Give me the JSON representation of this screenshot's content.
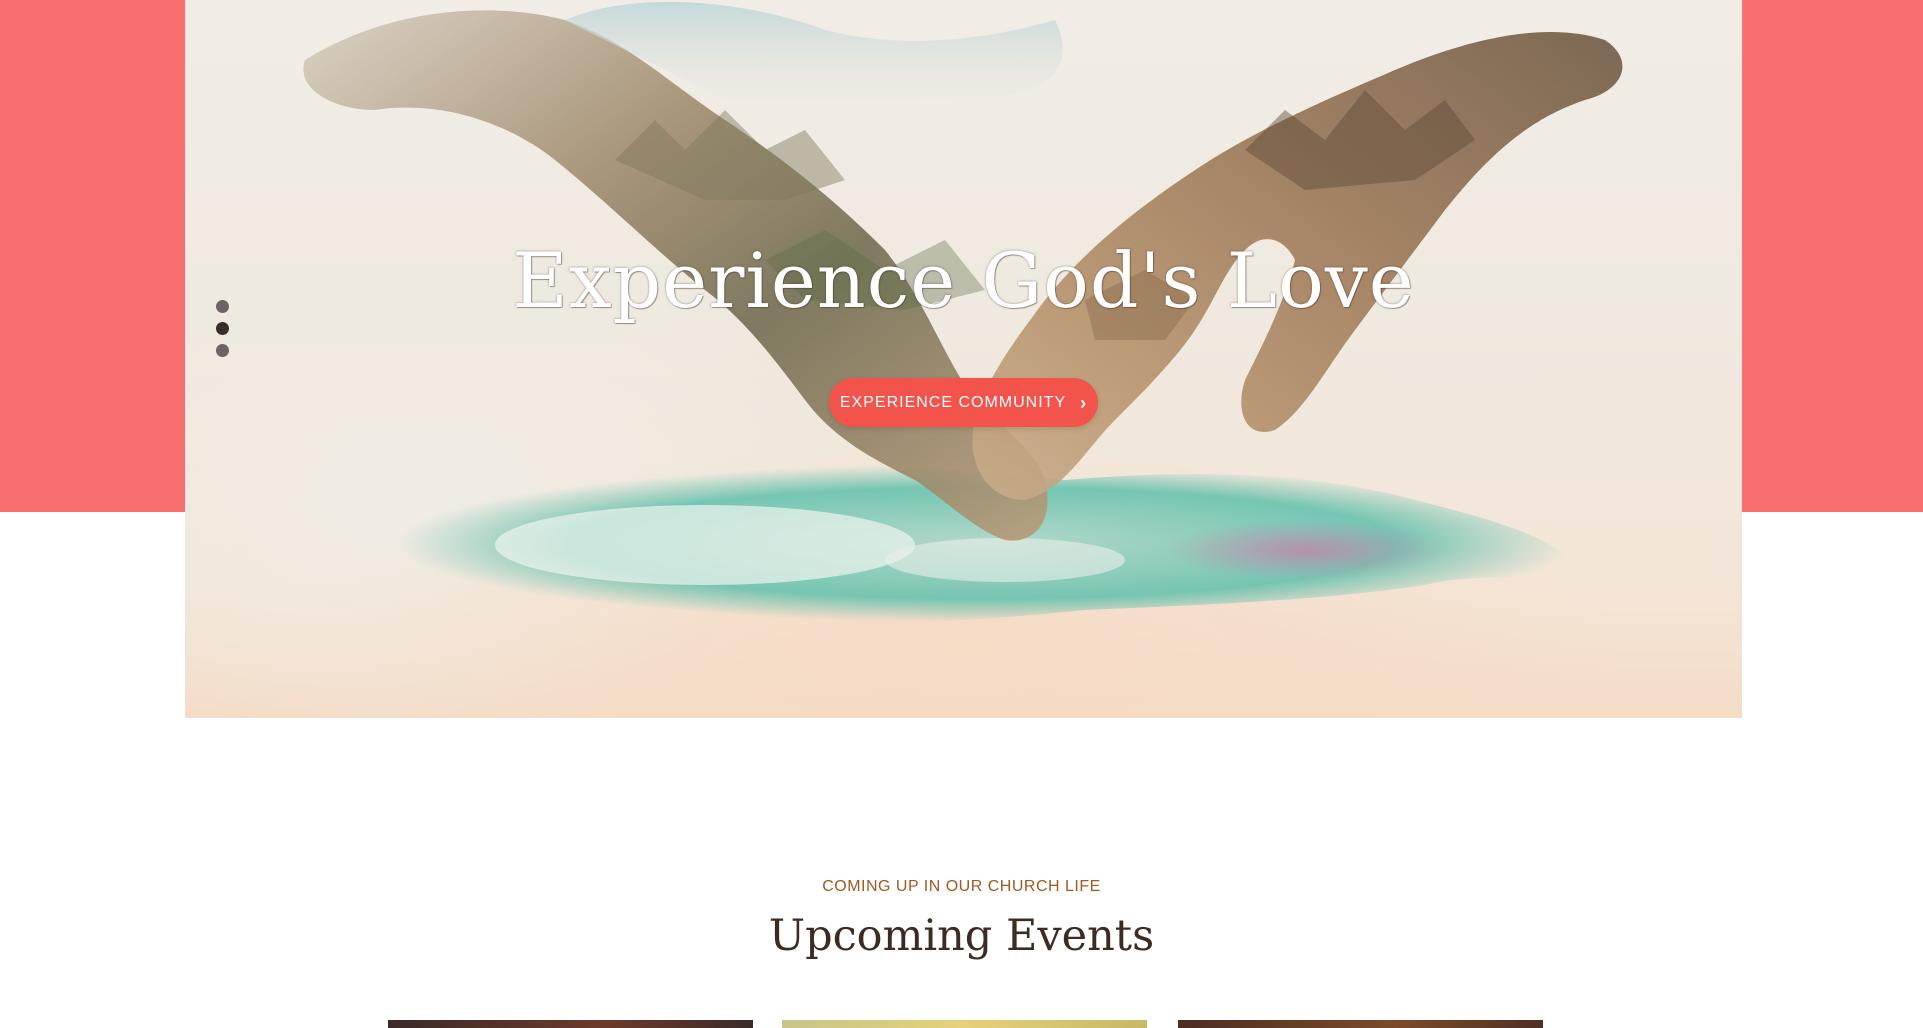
{
  "hero": {
    "title": "Experience God's Love",
    "cta_label": "EXPERIENCE COMMUNITY",
    "cta_icon": "chevron-right-icon",
    "slider": {
      "slide_count": 3,
      "active_index": 1
    },
    "accent_color": "#f96f6e",
    "button_color": "#f2534a"
  },
  "events": {
    "kicker": "COMING UP IN OUR CHURCH LIFE",
    "title": "Upcoming Events",
    "kicker_color": "#a2581f",
    "title_color": "#3d2b22"
  }
}
